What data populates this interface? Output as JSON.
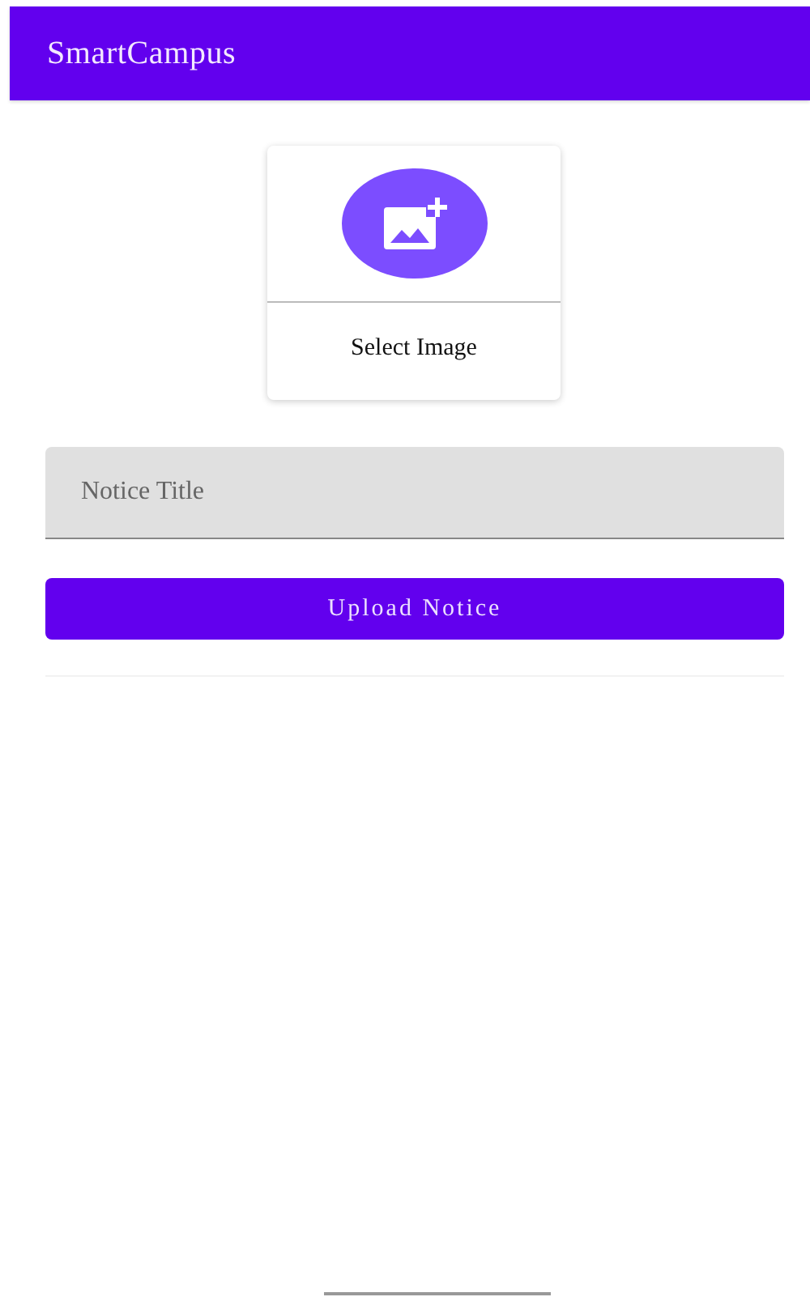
{
  "app_bar": {
    "title": "SmartCampus"
  },
  "image_picker": {
    "label": "Select Image"
  },
  "title_field": {
    "placeholder": "Notice Title"
  },
  "upload_button": {
    "label": "Upload Notice"
  }
}
